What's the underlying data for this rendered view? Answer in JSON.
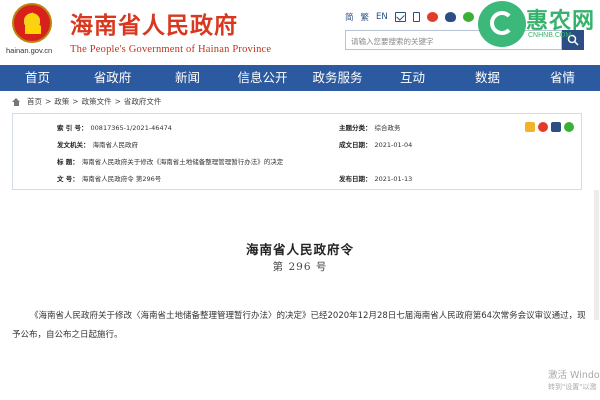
{
  "header": {
    "site_domain": "hainan.gov.cn",
    "title_cn": "海南省人民政府",
    "title_en": "The People's Government of Hainan Province",
    "top_links": [
      "简",
      "繁",
      "EN"
    ],
    "search_placeholder": "请输入您要搜索的关键字"
  },
  "watermark_logo": {
    "text": "惠农网",
    "sub": "CNHNB.COM",
    "color": "#35b36d"
  },
  "nav": {
    "items": [
      "首页",
      "省政府",
      "新闻",
      "信息公开",
      "政务服务",
      "互动",
      "数据",
      "省情"
    ],
    "bg_color": "#2c5aa0"
  },
  "breadcrumb": {
    "items": [
      "首页",
      "政策",
      "政策文件",
      "省政府文件"
    ],
    "separator": ">"
  },
  "info": {
    "index_label": "索   引   号：",
    "index_value": "00817365-1/2021-46474",
    "issuer_label": "发文机关：",
    "issuer_value": "海南省人民政府",
    "subject_label": "标        题：",
    "subject_value": "海南省人民政府关于修改《海南省土地储备整理管理暂行办法》的决定",
    "docno_label": "文        号：",
    "docno_value": "海南省人民政府令 第296号",
    "category_label": "主题分类：",
    "category_value": "综合政务",
    "created_label": "成文日期：",
    "created_value": "2021-01-04",
    "published_label": "发布日期：",
    "published_value": "2021-01-13"
  },
  "document": {
    "title": "海南省人民政府令",
    "number": "第 296 号",
    "paragraph": "《海南省人民政府关于修改〈海南省土地储备整理管理暂行办法〉的决定》已经2020年12月28日七届海南省人民政府第64次常务会议审议通过，现予公布，自公布之日起施行。"
  },
  "os_watermark": {
    "line1": "激活 Windo",
    "line2": "转到\"设置\"以激"
  }
}
